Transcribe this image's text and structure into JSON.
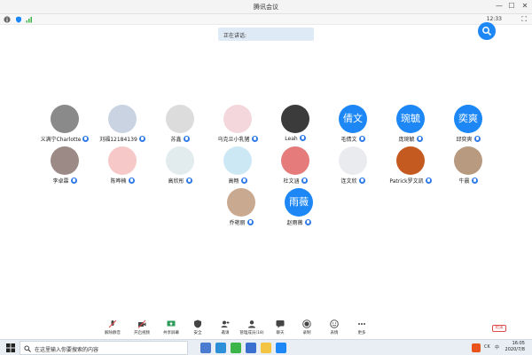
{
  "window": {
    "title": "腾讯会议"
  },
  "infobar": {
    "time": "12:33"
  },
  "speaking": {
    "label": "正在讲话:"
  },
  "participants": [
    {
      "name": "义满宁Charlotte",
      "avatar_text": "",
      "avatar_color": "#8a8a8a"
    },
    {
      "name": "刘福12184139",
      "avatar_text": "",
      "avatar_color": "#c9d3e1"
    },
    {
      "name": "苏鑫",
      "avatar_text": "",
      "avatar_color": "#dcdcdc"
    },
    {
      "name": "乌克兰小乳猪",
      "avatar_text": "",
      "avatar_color": "#f3d7dd"
    },
    {
      "name": "Leah",
      "avatar_text": "",
      "avatar_color": "#3b3b3b"
    },
    {
      "name": "毛倩文",
      "avatar_text": "倩文",
      "avatar_color": "#1c87f5"
    },
    {
      "name": "庞琬毓",
      "avatar_text": "琬毓",
      "avatar_color": "#1c87f5"
    },
    {
      "name": "邱奕爽",
      "avatar_text": "奕爽",
      "avatar_color": "#1c87f5"
    },
    {
      "name": "李卓霖",
      "avatar_text": "",
      "avatar_color": "#9b8a86"
    },
    {
      "name": "陈晔楠",
      "avatar_text": "",
      "avatar_color": "#f7c8c8"
    },
    {
      "name": "高欣彤",
      "avatar_text": "",
      "avatar_color": "#e2ecef"
    },
    {
      "name": "高畅",
      "avatar_text": "",
      "avatar_color": "#cde8f5"
    },
    {
      "name": "杜文涵",
      "avatar_text": "",
      "avatar_color": "#e57b7b"
    },
    {
      "name": "连文欣",
      "avatar_text": "",
      "avatar_color": "#e9ebef"
    },
    {
      "name": "Patrick罗文凯",
      "avatar_text": "",
      "avatar_color": "#c45a1f"
    },
    {
      "name": "牛晨",
      "avatar_text": "",
      "avatar_color": "#b79a80"
    },
    {
      "name": "乔艳丽",
      "avatar_text": "",
      "avatar_color": "#c9a98f"
    },
    {
      "name": "赵雨薇",
      "avatar_text": "雨薇",
      "avatar_color": "#1c87f5"
    }
  ],
  "toolbar": {
    "items": [
      {
        "label": "解除静音",
        "icon": "mic-muted-icon"
      },
      {
        "label": "开启视频",
        "icon": "video-off-icon"
      },
      {
        "label": "共享屏幕",
        "icon": "share-screen-icon"
      },
      {
        "label": "安全",
        "icon": "shield-icon"
      },
      {
        "label": "邀请",
        "icon": "invite-icon"
      },
      {
        "label": "管理成员(18)",
        "icon": "members-icon"
      },
      {
        "label": "聊天",
        "icon": "chat-icon"
      },
      {
        "label": "录制",
        "icon": "record-icon"
      },
      {
        "label": "表情",
        "icon": "emoji-icon"
      },
      {
        "label": "更多",
        "icon": "more-icon"
      }
    ],
    "end_label": "结束"
  },
  "taskbar": {
    "search_placeholder": "在这里输入你要搜索的内容",
    "tray_lang": "CK",
    "tray_ime": "中",
    "time": "16:05",
    "date": "2020/7/8"
  }
}
